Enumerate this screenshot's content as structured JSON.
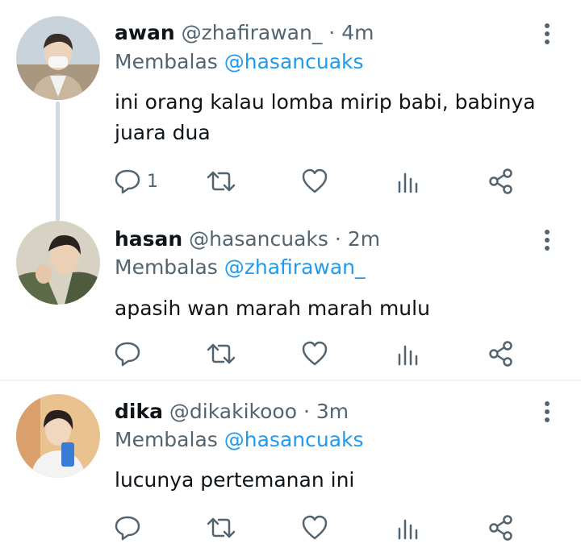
{
  "tweets": [
    {
      "name": "awan",
      "handle": "@zhafirawan_",
      "time": "4m",
      "reply_prefix": "Membalas",
      "reply_to": "@hasancuaks",
      "text": "ini orang kalau lomba mirip babi, babinya juara dua",
      "reply_count": "1",
      "avatar_colors": [
        "#c9b7a6",
        "#6e8aa3",
        "#e8d9c9"
      ]
    },
    {
      "name": "hasan",
      "handle": "@hasancuaks",
      "time": "2m",
      "reply_prefix": "Membalas",
      "reply_to": "@zhafirawan_",
      "text": "apasih wan marah marah mulu",
      "reply_count": "",
      "avatar_colors": [
        "#6b7a5a",
        "#3f4a36",
        "#d6c2a8"
      ]
    },
    {
      "name": "dika",
      "handle": "@dikakikooo",
      "time": "3m",
      "reply_prefix": "Membalas",
      "reply_to": "@hasancuaks",
      "text": "lucunya pertemanan ini",
      "reply_count": "",
      "avatar_colors": [
        "#d9a06b",
        "#3a7bd5",
        "#f2e0cc"
      ]
    }
  ],
  "separator": "·",
  "icons": {
    "reply": "reply-icon",
    "retweet": "retweet-icon",
    "like": "heart-icon",
    "views": "analytics-icon",
    "share": "share-icon",
    "more": "more-vertical-icon"
  },
  "colors": {
    "accent": "#1d9bf0",
    "muted": "#536471",
    "text": "#0f1419",
    "thread_line": "#cfd9de"
  }
}
